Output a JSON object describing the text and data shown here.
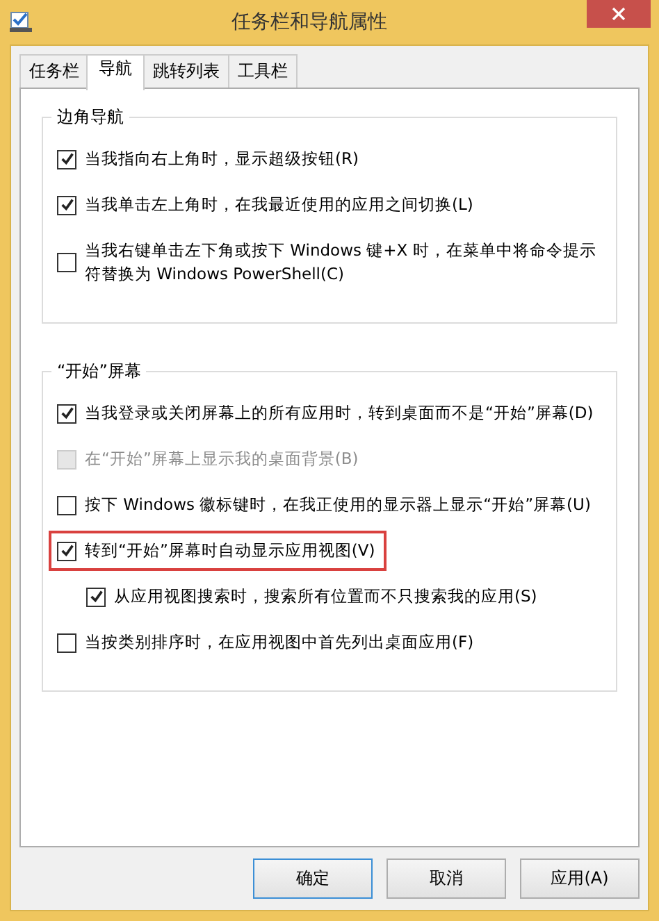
{
  "window": {
    "title": "任务栏和导航属性"
  },
  "tabs": [
    {
      "label": "任务栏",
      "selected": false
    },
    {
      "label": "导航",
      "selected": true
    },
    {
      "label": "跳转列表",
      "selected": false
    },
    {
      "label": "工具栏",
      "selected": false
    }
  ],
  "groups": [
    {
      "title": "边角导航",
      "items": [
        {
          "label": "当我指向右上角时，显示超级按钮(R)",
          "checked": true,
          "disabled": false,
          "highlighted": false
        },
        {
          "label": "当我单击左上角时，在我最近使用的应用之间切换(L)",
          "checked": true,
          "disabled": false,
          "highlighted": false
        },
        {
          "label": "当我右键单击左下角或按下 Windows 键+X 时，在菜单中将命令提示符替换为 Windows PowerShell(C)",
          "checked": false,
          "disabled": false,
          "highlighted": false
        }
      ]
    },
    {
      "title": "“开始”屏幕",
      "items": [
        {
          "label": "当我登录或关闭屏幕上的所有应用时，转到桌面而不是“开始”屏幕(D)",
          "checked": true,
          "disabled": false,
          "highlighted": false
        },
        {
          "label": "在“开始”屏幕上显示我的桌面背景(B)",
          "checked": false,
          "disabled": true,
          "highlighted": false
        },
        {
          "label": "按下 Windows 徽标键时，在我正使用的显示器上显示“开始”屏幕(U)",
          "checked": false,
          "disabled": false,
          "highlighted": false
        },
        {
          "label": "转到“开始”屏幕时自动显示应用视图(V)",
          "checked": true,
          "disabled": false,
          "highlighted": true,
          "children": [
            {
              "label": "从应用视图搜索时，搜索所有位置而不只搜索我的应用(S)",
              "checked": true,
              "disabled": false,
              "highlighted": false
            }
          ]
        },
        {
          "label": "当按类别排序时，在应用视图中首先列出桌面应用(F)",
          "checked": false,
          "disabled": false,
          "highlighted": false
        }
      ]
    }
  ],
  "buttons": [
    {
      "label": "确定",
      "default": true
    },
    {
      "label": "取消",
      "default": false
    },
    {
      "label": "应用(A)",
      "default": false
    }
  ]
}
